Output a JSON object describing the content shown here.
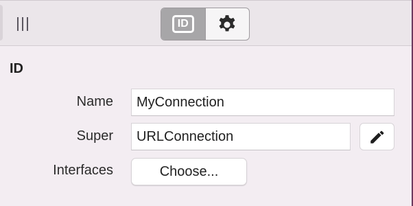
{
  "toolbar": {
    "segments": [
      {
        "id": "identity",
        "icon": "id-icon",
        "badge_text": "ID",
        "selected": true
      },
      {
        "id": "settings",
        "icon": "gear-icon",
        "selected": false
      }
    ]
  },
  "section": {
    "title": "ID"
  },
  "form": {
    "name_label": "Name",
    "name_value": "MyConnection",
    "super_label": "Super",
    "super_value": "URLConnection",
    "edit_icon": "pencil-icon",
    "interfaces_label": "Interfaces",
    "choose_label": "Choose..."
  },
  "colors": {
    "window_edge": "#6d3b5f",
    "panel_background": "#f3edf2",
    "selected_segment": "#a7a6a8"
  }
}
